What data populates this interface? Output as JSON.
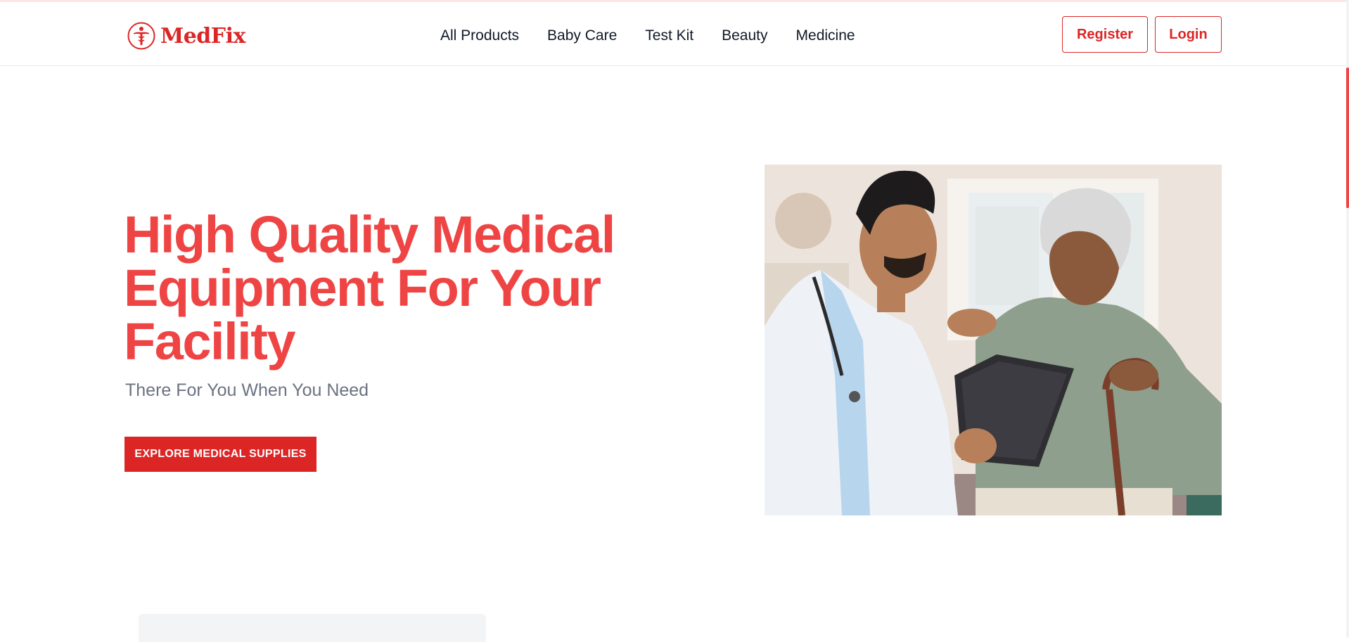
{
  "brand": {
    "name": "MedFix",
    "logo_icon": "caduceus-figure-icon",
    "color": "#dc2626"
  },
  "nav": {
    "items": [
      {
        "label": "All Products"
      },
      {
        "label": "Baby Care"
      },
      {
        "label": "Test Kit"
      },
      {
        "label": "Beauty"
      },
      {
        "label": "Medicine"
      }
    ]
  },
  "auth": {
    "register_label": "Register",
    "login_label": "Login"
  },
  "hero": {
    "title": "High Quality Medical Equipment For Your Facility",
    "subtitle": "There For You When You Need",
    "cta_label": "EXPLORE MEDICAL SUPPLIES",
    "image_subject": "doctor-with-tablet-and-elderly-patient-photo"
  },
  "colors": {
    "accent": "#ef4444",
    "button": "#dc2626",
    "subtitle": "#6b7280",
    "text": "#111827"
  }
}
